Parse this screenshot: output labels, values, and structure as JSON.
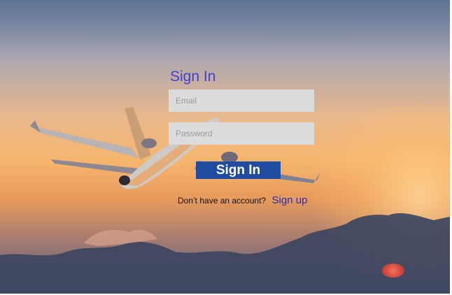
{
  "login": {
    "title": "Sign In",
    "email_placeholder": "Email",
    "password_placeholder": "Password",
    "submit_label": "Sign In",
    "no_account_text": "Don’t have an account?",
    "signup_label": "Sign up"
  },
  "colors": {
    "title": "#3f3fd1",
    "button": "#1f4ba0",
    "field": "#dcdcdc",
    "link": "#2b2ba8"
  }
}
